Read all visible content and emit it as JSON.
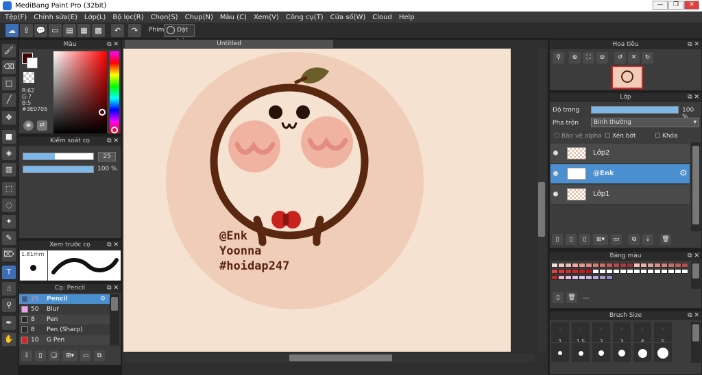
{
  "window": {
    "title": "MediBang Paint Pro (32bit)",
    "min": "—",
    "max": "❐",
    "close": "✕"
  },
  "menu": [
    "Tệp(F)",
    "Chỉnh sửa(E)",
    "Lớp(L)",
    "Bộ lọc(R)",
    "Chọn(S)",
    "Chụp(N)",
    "Màu (C)",
    "Xem(V)",
    "Công cụ(T)",
    "Cửa số(W)",
    "Cloud",
    "Help"
  ],
  "toolbar": {
    "hand_label": "Phím",
    "reset_label": "Đặt lại"
  },
  "color_panel": {
    "title": "Màu",
    "r": "R:62",
    "g": "G:7",
    "b": "B:5",
    "hex": "#3E0705",
    "fg": "#3E0705"
  },
  "brush_control": {
    "title": "Kiểm soát cọ",
    "size": "25",
    "opacity": "100 %",
    "size_frac": 0.45,
    "opacity_frac": 1.0
  },
  "brush_preview": {
    "title": "Xem trước cọ",
    "size": "1.81mm"
  },
  "brush_list": {
    "title": "Cọ: Pencil",
    "items": [
      {
        "size": "25",
        "name": "Pencil",
        "color": "#3a5e9a",
        "selected": true
      },
      {
        "size": "50",
        "name": "Blur",
        "color": "#f0a0f0",
        "selected": false
      },
      {
        "size": "8",
        "name": "Pen",
        "color": "#2a2a2a",
        "selected": false
      },
      {
        "size": "8",
        "name": "Pen (Sharp)",
        "color": "#2a2a2a",
        "selected": false
      },
      {
        "size": "10",
        "name": "G Pen",
        "color": "#e02020",
        "selected": false
      }
    ]
  },
  "document": {
    "tab": "Untitled"
  },
  "artwork": {
    "lines": [
      "@Enk",
      "Yoonna",
      "#hoidap247"
    ]
  },
  "navigator": {
    "title": "Hoa tiêu"
  },
  "layers": {
    "title": "Lớp",
    "opacity_label": "Độ trong",
    "opacity_value": "100 %",
    "blend_label": "Pha trộn",
    "blend_value": "Bình thường",
    "protect_alpha": "Bảo vệ alpha",
    "clip": "Xén bớt",
    "lock": "Khóa",
    "items": [
      {
        "name": "Lớp2",
        "selected": false
      },
      {
        "name": "@Enk",
        "selected": true
      },
      {
        "name": "Lớp1",
        "selected": false
      }
    ]
  },
  "palette": {
    "title": "Bảng màu",
    "selected_label": "---",
    "rows": [
      [
        "#f8d8d0",
        "#f3c9c0",
        "#efb8b0",
        "#eaa8a0",
        "#e69890",
        "#e08a80",
        "#d87a72",
        "#cc6a64",
        "#c05a58",
        "#b44a4c",
        "#a83c42",
        "#9c3038",
        "#f0c0b8",
        "#e8b0a8",
        "#e0a098",
        "#d89088",
        "#d08078",
        "#c87068",
        "#c06060",
        "#b85050"
      ],
      [
        "#e04040",
        "#d83838",
        "#d03030",
        "#c82828",
        "#c02020",
        "#b81818",
        "#ffffff",
        "#ffffff",
        "#ffffff",
        "#ffffff",
        "#ffffff",
        "#ffffff",
        "#ffffff",
        "#ffffff",
        "#ffffff",
        "#ffffff",
        "#ffffff",
        "#ffffff",
        "#ffffff",
        "#ffffff"
      ],
      [
        "#d02020",
        "#f0b8d0",
        "#e8b8e0",
        "#e0c0e8",
        "#d8c8ec",
        "#c8b8e0",
        "#b8a8d8",
        "#a898cc",
        "#9888c0"
      ]
    ]
  },
  "brush_size": {
    "title": "Brush Size",
    "top": [
      "·",
      "·",
      "·",
      "·",
      "·",
      "·"
    ],
    "labels": [
      "1",
      "1.5",
      "2",
      "3",
      "4",
      "5"
    ]
  }
}
